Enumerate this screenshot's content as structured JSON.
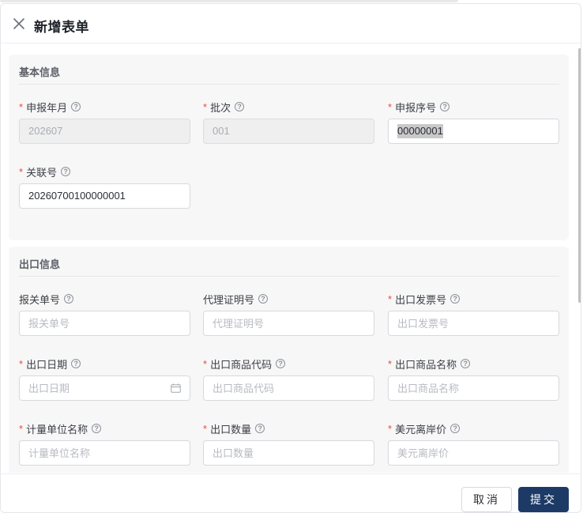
{
  "dialog": {
    "title": "新增表单",
    "close_icon": "close-icon"
  },
  "basic_section": {
    "title": "基本信息",
    "fields": {
      "report_month": {
        "label": "申报年月",
        "required": true,
        "value": "202607",
        "disabled": true
      },
      "batch": {
        "label": "批次",
        "required": true,
        "value": "001",
        "disabled": true
      },
      "report_seq": {
        "label": "申报序号",
        "required": true,
        "value": "00000001",
        "selected": true
      },
      "link_no": {
        "label": "关联号",
        "required": true,
        "value": "20260700100000001"
      }
    }
  },
  "export_section": {
    "title": "出口信息",
    "fields": {
      "customs_no": {
        "label": "报关单号",
        "required": false,
        "placeholder": "报关单号"
      },
      "agent_cert_no": {
        "label": "代理证明号",
        "required": false,
        "placeholder": "代理证明号"
      },
      "invoice_no": {
        "label": "出口发票号",
        "required": true,
        "placeholder": "出口发票号"
      },
      "export_date": {
        "label": "出口日期",
        "required": true,
        "placeholder": "出口日期",
        "icon": "calendar-icon"
      },
      "goods_code": {
        "label": "出口商品代码",
        "required": true,
        "placeholder": "出口商品代码"
      },
      "goods_name": {
        "label": "出口商品名称",
        "required": true,
        "placeholder": "出口商品名称"
      },
      "unit_name": {
        "label": "计量单位名称",
        "required": true,
        "placeholder": "计量单位名称"
      },
      "quantity": {
        "label": "出口数量",
        "required": true,
        "placeholder": "出口数量"
      },
      "fob_usd": {
        "label": "美元离岸价",
        "required": true,
        "placeholder": "美元离岸价"
      }
    }
  },
  "footer": {
    "cancel_label": "取消",
    "submit_label": "提交"
  },
  "colors": {
    "primary": "#1d3a66",
    "required_mark": "#e74c3c",
    "section_bg": "#f7f7f7"
  }
}
